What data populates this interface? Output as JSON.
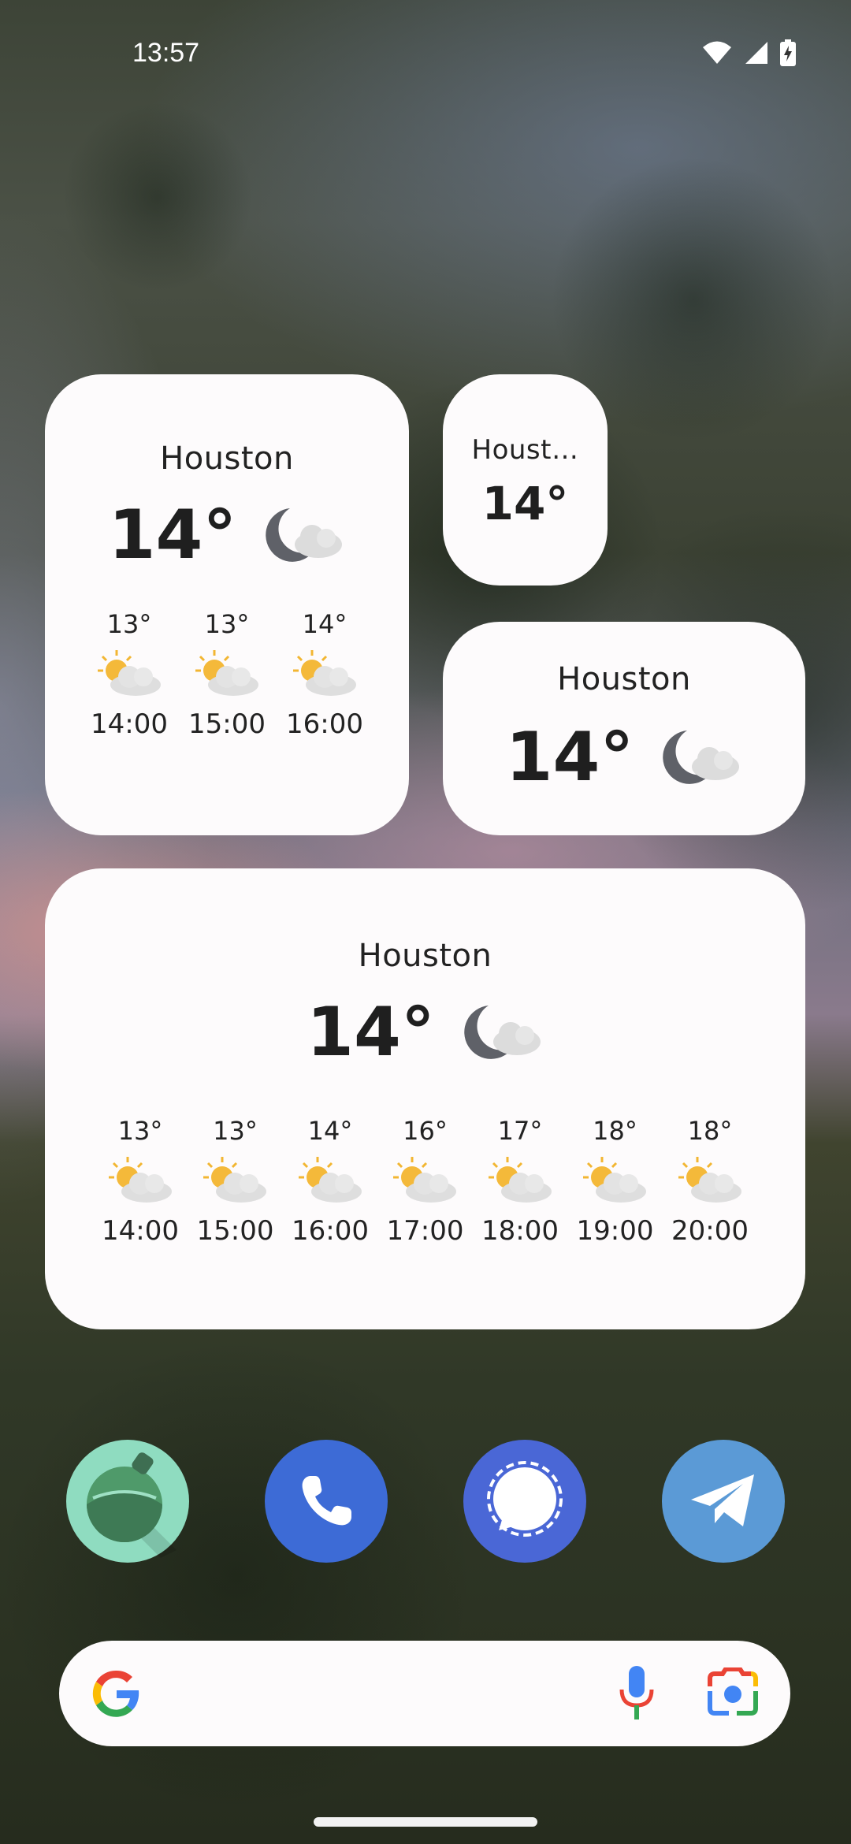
{
  "status_bar": {
    "time": "13:57",
    "icons": [
      "wifi-icon",
      "cell-signal-icon",
      "battery-charging-icon"
    ]
  },
  "widgets": {
    "large": {
      "city": "Houston",
      "temp": "14°",
      "icon": "partly-cloudy-night-icon",
      "forecast": [
        {
          "temp": "13°",
          "time": "14:00",
          "icon": "partly-cloudy-day-icon"
        },
        {
          "temp": "13°",
          "time": "15:00",
          "icon": "partly-cloudy-day-icon"
        },
        {
          "temp": "14°",
          "time": "16:00",
          "icon": "partly-cloudy-day-icon"
        }
      ]
    },
    "small": {
      "city": "Houst…",
      "temp": "14°"
    },
    "medium": {
      "city": "Houston",
      "temp": "14°",
      "icon": "partly-cloudy-night-icon"
    },
    "wide": {
      "city": "Houston",
      "temp": "14°",
      "icon": "partly-cloudy-night-icon",
      "forecast": [
        {
          "temp": "13°",
          "time": "14:00",
          "icon": "partly-cloudy-day-icon"
        },
        {
          "temp": "13°",
          "time": "15:00",
          "icon": "partly-cloudy-day-icon"
        },
        {
          "temp": "14°",
          "time": "16:00",
          "icon": "partly-cloudy-day-icon"
        },
        {
          "temp": "16°",
          "time": "17:00",
          "icon": "partly-cloudy-day-icon"
        },
        {
          "temp": "17°",
          "time": "18:00",
          "icon": "partly-cloudy-day-icon"
        },
        {
          "temp": "18°",
          "time": "19:00",
          "icon": "partly-cloudy-day-icon"
        },
        {
          "temp": "18°",
          "time": "20:00",
          "icon": "partly-cloudy-day-icon"
        }
      ]
    }
  },
  "dock": [
    {
      "name": "potion-app-icon",
      "color": "#8fdcc0"
    },
    {
      "name": "phone-app-icon",
      "color": "#3d6bd6"
    },
    {
      "name": "signal-app-icon",
      "color": "#4a67d6"
    },
    {
      "name": "telegram-app-icon",
      "color": "#5b9ad6"
    }
  ],
  "search_bar": {
    "icons": [
      "google-g-icon",
      "microphone-icon",
      "google-lens-icon"
    ]
  }
}
